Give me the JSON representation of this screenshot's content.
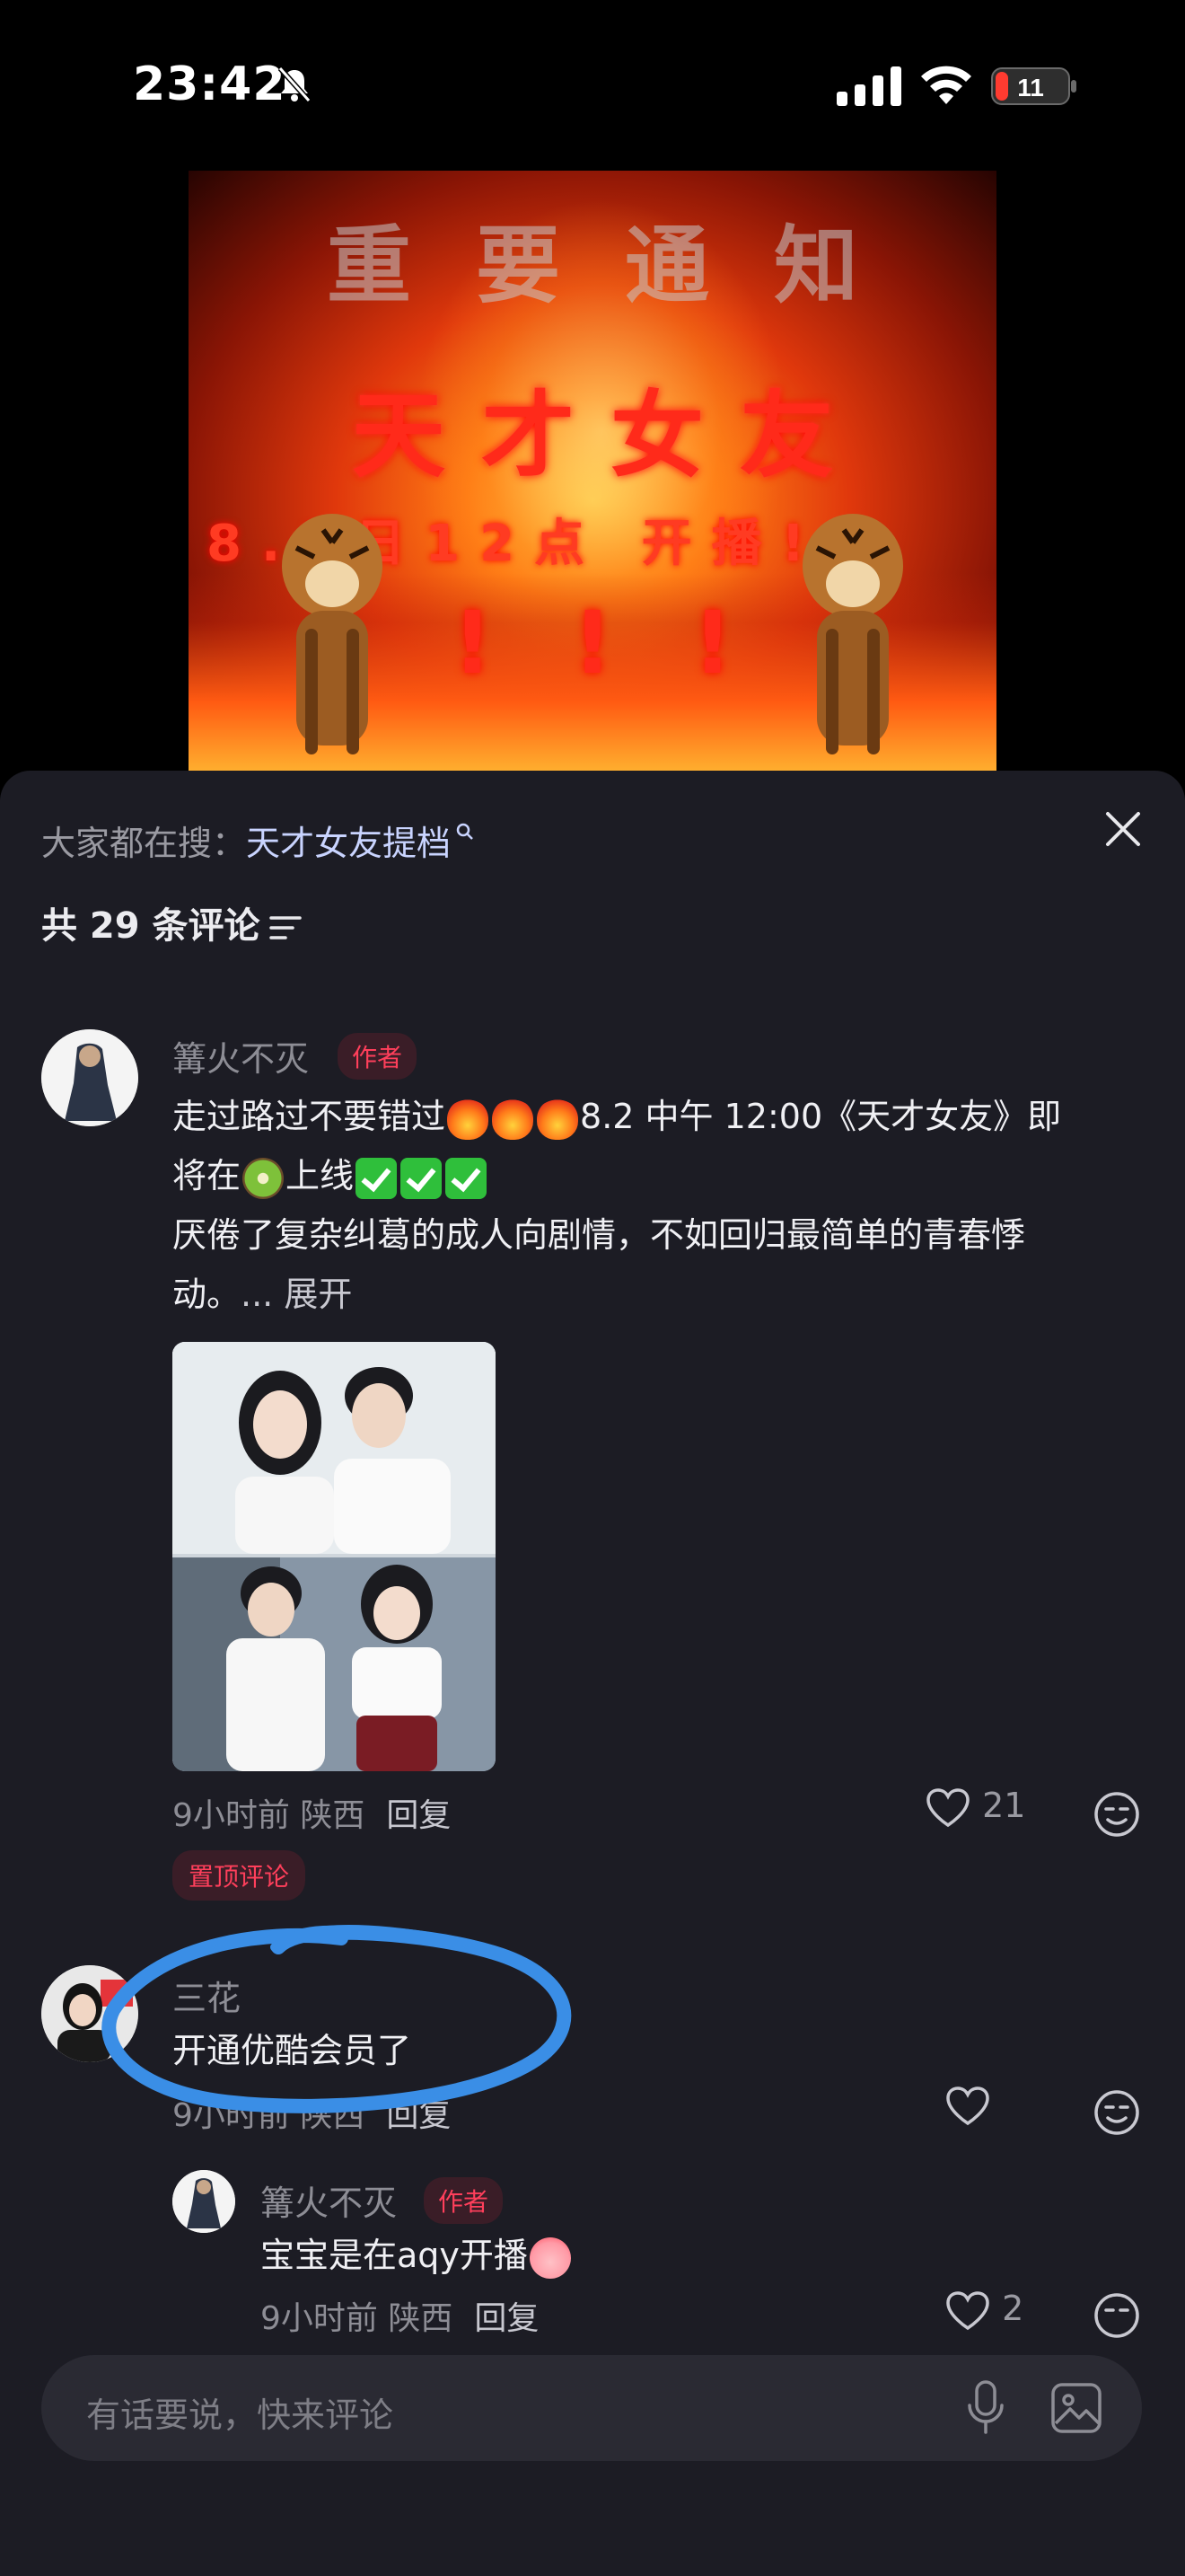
{
  "status_bar": {
    "time": "23:42",
    "battery": "11"
  },
  "poster": {
    "notice": "重要通知",
    "title": "天才女友",
    "date_line": "8.2日12点 开播!",
    "exclaim": "!!!"
  },
  "sheet": {
    "search_prefix": "大家都在搜：",
    "search_keyword": "天才女友提档",
    "comment_count": "共 29 条评论"
  },
  "comments": [
    {
      "user": "篝火不灭",
      "tag": "作者",
      "text_1": "走过路过不要错过",
      "text_2": "8.2 中午 12:00《天才女友》即",
      "text_3": "将在",
      "text_4": "上线",
      "text_5": "厌倦了复杂纠葛的成人向剧情，不如回归最简单的青春悸",
      "text_6": "动。",
      "expand": "... 展开",
      "time": "9小时前",
      "location": "陕西",
      "reply": "回复",
      "likes": "21",
      "pinned": "置顶评论"
    },
    {
      "user": "三花",
      "text": "开通优酷会员了",
      "time": "9小时前",
      "location": "陕西",
      "reply": "回复"
    },
    {
      "user": "篝火不灭",
      "tag": "作者",
      "text": "宝宝是在aqy开播",
      "time": "9小时前",
      "location": "陕西",
      "reply": "回复",
      "likes": "2"
    }
  ],
  "input": {
    "placeholder": "有话要说，快来评论"
  },
  "colors": {
    "sheet_bg": "#1c1c24",
    "author_tag": "#ff3f5b",
    "annotation": "#3a8ee6"
  },
  "icons": [
    "bell-slash-icon",
    "signal-icon",
    "wifi-icon",
    "battery-icon",
    "close-icon",
    "filter-icon",
    "heart-icon",
    "emoji-face-icon",
    "mic-icon",
    "image-icon"
  ]
}
